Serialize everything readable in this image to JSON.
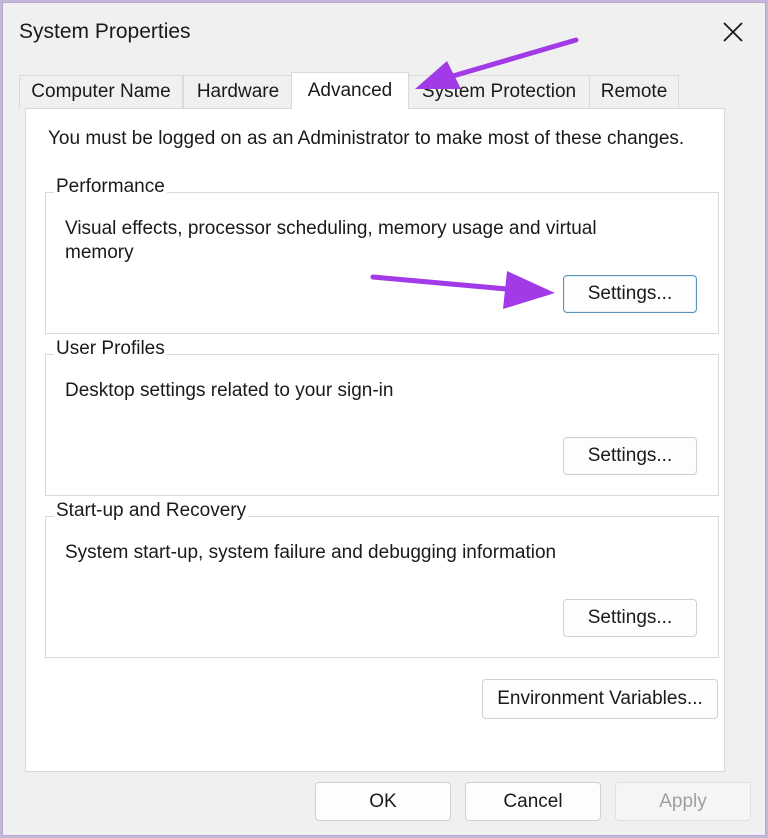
{
  "window": {
    "title": "System Properties"
  },
  "tabs": [
    {
      "label": "Computer Name"
    },
    {
      "label": "Hardware"
    },
    {
      "label": "Advanced"
    },
    {
      "label": "System Protection"
    },
    {
      "label": "Remote"
    }
  ],
  "active_tab": "Advanced",
  "notice": "You must be logged on as an Administrator to make most of these changes.",
  "groups": {
    "performance": {
      "label": "Performance",
      "desc": "Visual effects, processor scheduling, memory usage and virtual memory",
      "button": "Settings..."
    },
    "user_profiles": {
      "label": "User Profiles",
      "desc": "Desktop settings related to your sign-in",
      "button": "Settings..."
    },
    "startup": {
      "label": "Start-up and Recovery",
      "desc": "System start-up, system failure and debugging information",
      "button": "Settings..."
    }
  },
  "env_button": "Environment Variables...",
  "footer": {
    "ok": "OK",
    "cancel": "Cancel",
    "apply": "Apply"
  },
  "colors": {
    "annotation_arrow": "#a23ae8",
    "focus_border": "#5a93b8"
  },
  "icons": {
    "close": "close-icon"
  }
}
